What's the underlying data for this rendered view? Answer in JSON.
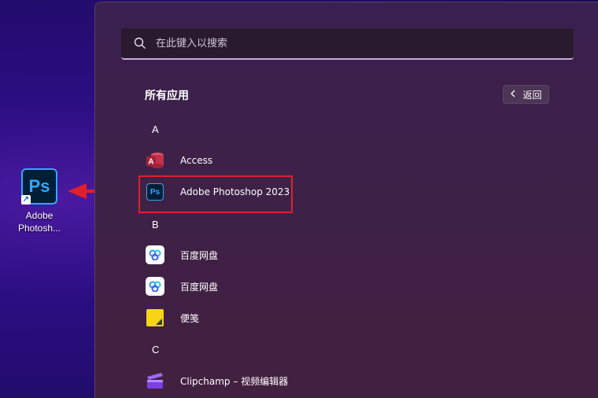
{
  "desktop": {
    "shortcut": {
      "icon_text": "Ps",
      "label_line1": "Adobe",
      "label_line2": "Photosh..."
    }
  },
  "start_menu": {
    "search": {
      "placeholder": "在此键入以搜索"
    },
    "section_title": "所有应用",
    "back_button": {
      "label": "返回"
    },
    "groups": [
      {
        "letter": "A",
        "apps": [
          {
            "name": "Access",
            "icon": "access-icon"
          },
          {
            "name": "Adobe Photoshop 2023",
            "icon": "photoshop-icon",
            "icon_text": "Ps"
          }
        ]
      },
      {
        "letter": "B",
        "apps": [
          {
            "name": "百度网盘",
            "icon": "baidu-netdisk-icon"
          },
          {
            "name": "百度网盘",
            "icon": "baidu-netdisk-icon"
          },
          {
            "name": "便笺",
            "icon": "sticky-notes-icon"
          }
        ]
      },
      {
        "letter": "C",
        "apps": [
          {
            "name": "Clipchamp – 视频编辑器",
            "icon": "clipchamp-icon"
          }
        ]
      }
    ]
  },
  "colors": {
    "highlight": "#e0202a",
    "photoshop_blue": "#31a8ff",
    "photoshop_bg": "#001e36",
    "access_red": "#c4314b"
  }
}
